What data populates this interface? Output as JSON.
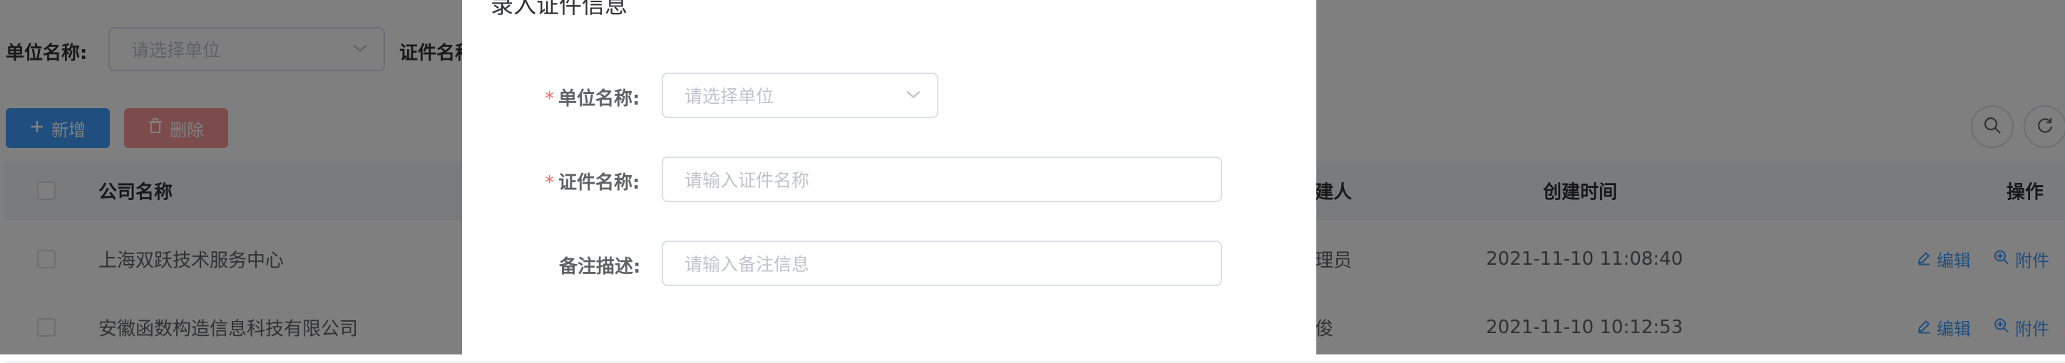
{
  "filters": {
    "unit_label": "单位名称:",
    "unit_placeholder": "请选择单位",
    "cert_label": "证件名称"
  },
  "toolbar": {
    "add_label": "新增",
    "delete_label": "删除"
  },
  "table": {
    "headers": {
      "company": "公司名称",
      "creator": "创建人",
      "created_at": "创建时间",
      "actions": "操作"
    },
    "rows": [
      {
        "company": "上海双跃技术服务中心",
        "creator": "管理员",
        "created_at": "2021-11-10 11:08:40",
        "edit": "编辑",
        "attach": "附件"
      },
      {
        "company": "安徽函数构造信息科技有限公司",
        "creator": "俊俊",
        "created_at": "2021-11-10 10:12:53",
        "edit": "编辑",
        "attach": "附件"
      }
    ]
  },
  "dialog": {
    "title": "录入证件信息",
    "required_mark": "*",
    "unit_label": "单位名称:",
    "unit_placeholder": "请选择单位",
    "cert_label": "证件名称:",
    "cert_placeholder": "请输入证件名称",
    "remark_label": "备注描述:",
    "remark_placeholder": "请输入备注信息"
  },
  "colors": {
    "primary": "#409eff",
    "danger": "#f56c6c",
    "overlay": "rgba(0,0,0,0.5)"
  },
  "icons": [
    "plus-icon",
    "trash-icon",
    "chevron-down-icon",
    "search-icon",
    "refresh-icon",
    "edit-icon",
    "attachment-search-icon"
  ]
}
